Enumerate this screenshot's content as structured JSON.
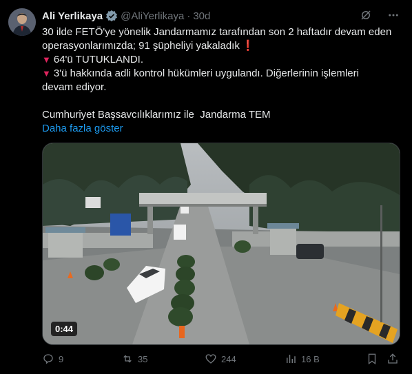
{
  "author": {
    "name": "Ali Yerlikaya",
    "handle": "@AliYerlikaya",
    "separator": "·",
    "time": "30d"
  },
  "tweet": {
    "line1": "30 ilde FETÖ'ye yönelik Jandarmamız tarafından son 2 haftadır devam eden",
    "line2": "operasyonlarımızda; 91 şüpheliyi yakaladık",
    "line2_emoji": "❗",
    "bullet": "▼",
    "line3": "64'ü TUTUKLANDI.",
    "line4": "3'ü hakkında adli kontrol hükümleri uygulandı. Diğerlerinin işlemleri",
    "line5": "devam ediyor.",
    "line6": "Cumhuriyet Başsavcılıklarımız ile  Jandarma TEM",
    "show_more": "Daha fazla göster"
  },
  "media": {
    "duration": "0:44"
  },
  "actions": {
    "replies": "9",
    "retweets": "35",
    "likes": "244",
    "views": "16 B"
  },
  "icons": {
    "verified": "verified-badge-icon",
    "grok": "grok-icon",
    "more": "more-icon",
    "reply": "reply-icon",
    "retweet": "retweet-icon",
    "like": "like-icon",
    "views": "views-icon",
    "bookmark": "bookmark-icon",
    "share": "share-icon"
  },
  "colors": {
    "background": "#000000",
    "text": "#e7e9ea",
    "muted": "#71767b",
    "link": "#1d9bf0",
    "red": "#e0245e"
  }
}
